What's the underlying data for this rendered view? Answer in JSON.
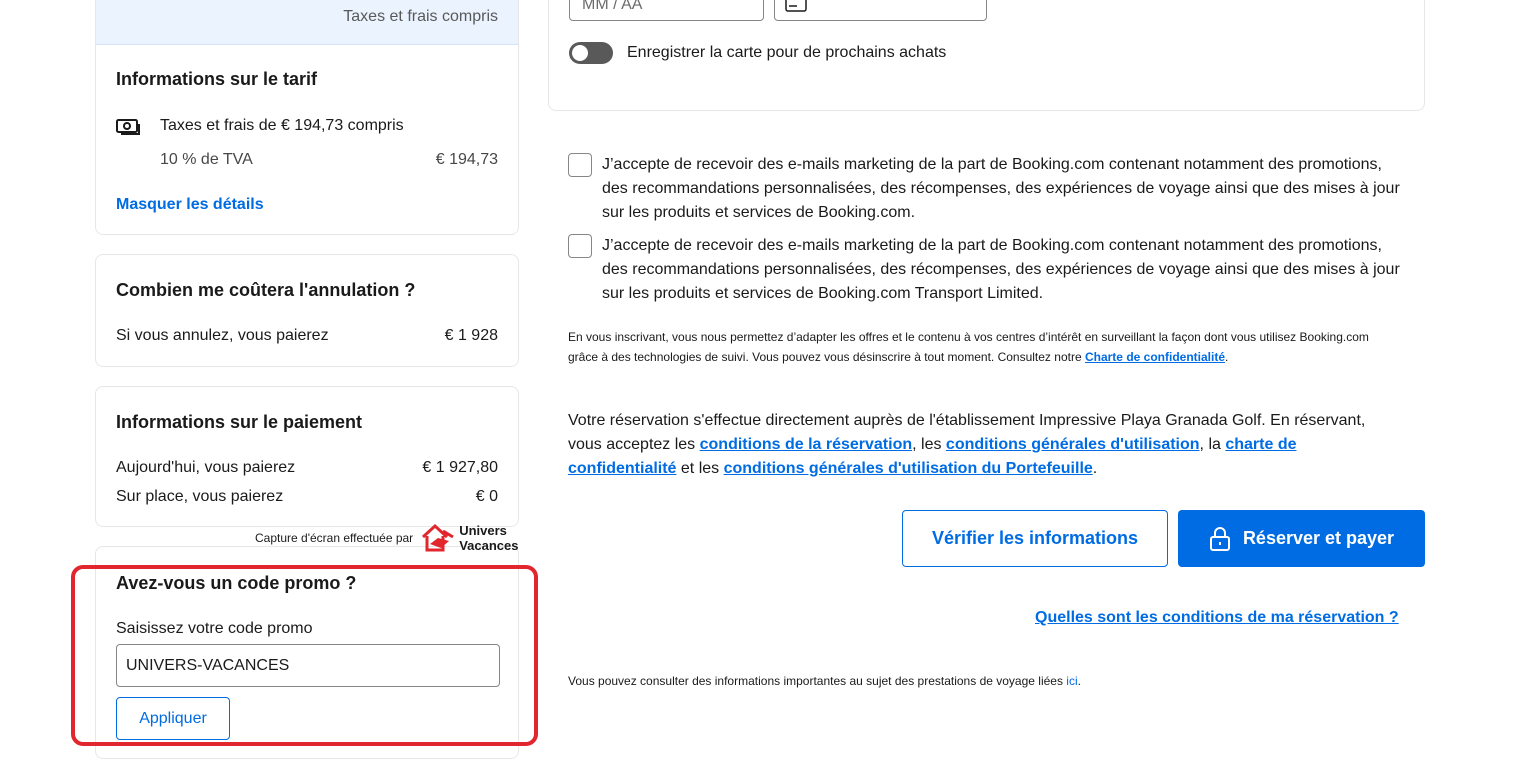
{
  "price_summary": {
    "taxes_note": "Taxes et frais compris"
  },
  "fare_info": {
    "title": "Informations sur le tarif",
    "taxes_line": "Taxes et frais de € 194,73 compris",
    "vat_label": "10 % de TVA",
    "vat_value": "€ 194,73",
    "hide_details": "Masquer les détails"
  },
  "cancellation": {
    "title": "Combien me coûtera l'annulation ?",
    "label": "Si vous annulez, vous paierez",
    "value": "€ 1 928"
  },
  "payment_info": {
    "title": "Informations sur le paiement",
    "today_label": "Aujourd'hui, vous paierez",
    "today_value": "€ 1 927,80",
    "onsite_label": "Sur place, vous paierez",
    "onsite_value": "€ 0"
  },
  "watermark": {
    "text": "Capture d'écran effectuée par",
    "brand_line1": "Univers",
    "brand_line2": "Vacances"
  },
  "promo": {
    "title": "Avez-vous un code promo ?",
    "label": "Saisissez votre code promo",
    "value": "UNIVERS-VACANCES",
    "apply": "Appliquer"
  },
  "card_form": {
    "expiry_placeholder": "MM / AA",
    "save_card_label": "Enregistrer la carte pour de prochains achats"
  },
  "consents": [
    {
      "text": "J’accepte de recevoir des e-mails marketing de la part de Booking.com contenant notamment des promotions, des recommandations personnalisées, des récompenses, des expériences de voyage ainsi que des mises à jour sur les produits et services de Booking.com."
    },
    {
      "text": "J’accepte de recevoir des e-mails marketing de la part de Booking.com contenant notamment des promotions, des recommandations personnalisées, des récompenses, des expériences de voyage ainsi que des mises à jour sur les produits et services de Booking.com Transport Limited."
    }
  ],
  "fine_print": {
    "text": "En vous inscrivant, vous nous permettez d’adapter les offres et le contenu à vos centres d’intérêt en surveillant la façon dont vous utilisez Booking.com grâce à des technologies de suivi. Vous pouvez vous désinscrire à tout moment. Consultez notre ",
    "link": "Charte de confidentialité",
    "end": "."
  },
  "terms": {
    "part1": "Votre réservation s'effectue directement auprès de l'établissement Impressive Playa Granada Golf. En réservant, vous acceptez les ",
    "link1": "conditions de la réservation",
    "part2": ", les ",
    "link2": "conditions générales d'utilisation",
    "part3": ", la ",
    "link3": "charte de confidentialité",
    "part4": " et les ",
    "link4": "conditions générales d'utilisation du Portefeuille",
    "part5": "."
  },
  "actions": {
    "verify": "Vérifier les informations",
    "book": "Réserver et payer"
  },
  "booking_conditions_link": "Quelles sont les conditions de ma réservation ?",
  "info_line": {
    "text": "Vous pouvez consulter des informations importantes au sujet des prestations de voyage liées ",
    "link": "ici",
    "end": "."
  },
  "colors": {
    "brand_blue": "#006ce4",
    "highlight_red": "#e1262d",
    "price_band": "#ebf3ff"
  },
  "icons": [
    "money-icon",
    "lock-icon",
    "card-icon",
    "univers-vacances-logo"
  ]
}
